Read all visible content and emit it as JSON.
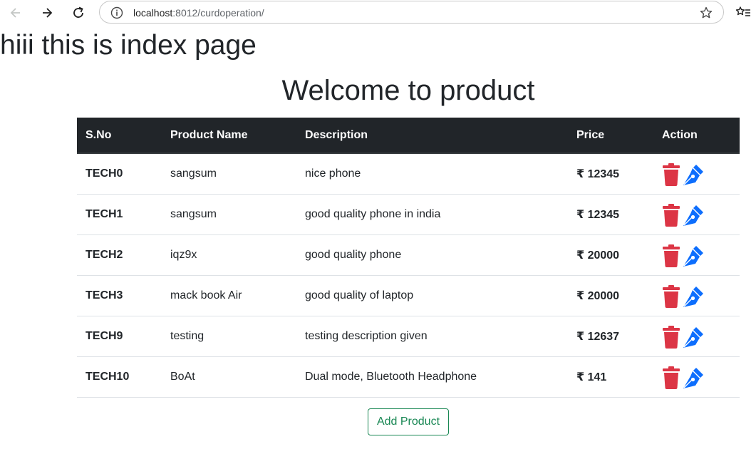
{
  "browser": {
    "url_host": "localhost",
    "url_path": ":8012/curdoperation/",
    "icons": [
      "back-arrow-icon",
      "forward-arrow-icon",
      "reload-icon",
      "info-icon",
      "star-icon",
      "bookmarks-list-icon"
    ]
  },
  "page": {
    "index_heading": "hiii this is index page",
    "title": "Welcome to product"
  },
  "table": {
    "headers": {
      "sno": "S.No",
      "name": "Product Name",
      "description": "Description",
      "price": "Price",
      "action": "Action"
    },
    "rows": [
      {
        "sno": "TECH0",
        "name": "sangsum",
        "description": "nice phone",
        "price": "₹ 12345"
      },
      {
        "sno": "TECH1",
        "name": "sangsum",
        "description": "good quality phone in india",
        "price": "₹ 12345"
      },
      {
        "sno": "TECH2",
        "name": "iqz9x",
        "description": "good quality phone",
        "price": "₹ 20000"
      },
      {
        "sno": "TECH3",
        "name": "mack book Air",
        "description": "good quality of laptop",
        "price": "₹ 20000"
      },
      {
        "sno": "TECH9",
        "name": "testing",
        "description": "testing description given",
        "price": "₹ 12637"
      },
      {
        "sno": "TECH10",
        "name": "BoAt",
        "description": "Dual mode, Bluetooth Headphone",
        "price": "₹ 141"
      }
    ],
    "row_icons": [
      "trash-icon",
      "pen-edit-icon"
    ]
  },
  "add_button": {
    "label": "Add Product"
  },
  "colors": {
    "table_header_bg": "#212529",
    "delete_icon": "#dc3545",
    "edit_icon": "#0d6efd",
    "add_button": "#198754"
  }
}
